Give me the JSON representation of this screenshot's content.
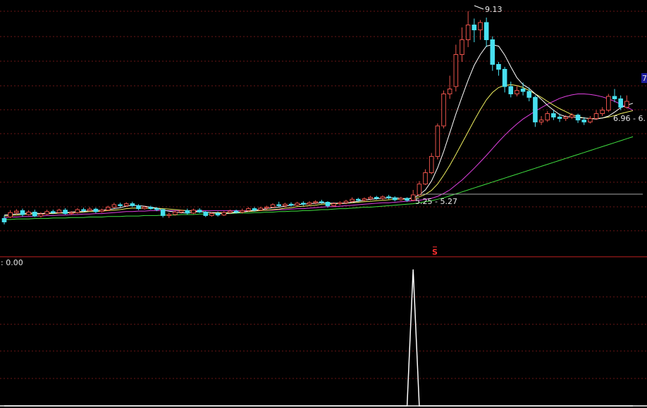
{
  "chart_data": [
    {
      "type": "candlestick",
      "ylim": [
        4.5,
        9.3
      ],
      "colors": {
        "up": "#e8524a",
        "down": "#48e0f0",
        "ma5": "#ffffff",
        "ma10": "#f0f060",
        "ma20": "#e040e0",
        "ma60": "#40e040",
        "grid": "#6a1616"
      },
      "annotations": {
        "high_label": "9.13",
        "range_label_mid": "5.25 - 5.27",
        "range_label_right": "6.96 - 6.",
        "edge_label": "7",
        "signal_marker": "S"
      },
      "candles": [
        [
          4.92,
          4.85,
          4.98,
          4.8
        ],
        [
          4.95,
          5.04,
          5.09,
          4.93
        ],
        [
          5.04,
          5.07,
          5.11,
          5.0
        ],
        [
          5.08,
          5.0,
          5.12,
          4.96
        ],
        [
          5.0,
          5.05,
          5.09,
          4.98
        ],
        [
          5.05,
          4.97,
          5.1,
          4.95
        ],
        [
          4.97,
          5.01,
          5.05,
          4.94
        ],
        [
          5.01,
          5.06,
          5.1,
          4.99
        ],
        [
          5.06,
          5.04,
          5.1,
          5.01
        ],
        [
          5.04,
          5.09,
          5.12,
          5.02
        ],
        [
          5.09,
          5.02,
          5.13,
          5.0
        ],
        [
          5.02,
          5.04,
          5.07,
          4.99
        ],
        [
          5.04,
          5.1,
          5.13,
          5.02
        ],
        [
          5.1,
          5.08,
          5.14,
          5.05
        ],
        [
          5.08,
          5.11,
          5.15,
          5.06
        ],
        [
          5.11,
          5.06,
          5.14,
          5.03
        ],
        [
          5.06,
          5.09,
          5.12,
          5.04
        ],
        [
          5.09,
          5.15,
          5.18,
          5.07
        ],
        [
          5.15,
          5.2,
          5.24,
          5.13
        ],
        [
          5.2,
          5.18,
          5.24,
          5.15
        ],
        [
          5.18,
          5.22,
          5.25,
          5.16
        ],
        [
          5.22,
          5.18,
          5.26,
          5.15
        ],
        [
          5.18,
          5.12,
          5.21,
          5.09
        ],
        [
          5.12,
          5.15,
          5.18,
          5.1
        ],
        [
          5.15,
          5.12,
          5.18,
          5.1
        ],
        [
          5.12,
          5.1,
          5.15,
          5.07
        ],
        [
          5.1,
          4.98,
          5.12,
          4.94
        ],
        [
          4.98,
          5.0,
          5.04,
          4.93
        ],
        [
          5.0,
          5.05,
          5.08,
          4.98
        ],
        [
          5.05,
          5.08,
          5.1,
          5.02
        ],
        [
          5.08,
          5.03,
          5.12,
          5.0
        ],
        [
          5.03,
          5.09,
          5.12,
          5.01
        ],
        [
          5.09,
          5.05,
          5.13,
          5.03
        ],
        [
          5.05,
          4.98,
          5.07,
          4.95
        ],
        [
          4.98,
          5.02,
          5.05,
          4.96
        ],
        [
          5.02,
          4.99,
          5.06,
          4.96
        ],
        [
          4.99,
          5.04,
          5.07,
          4.97
        ],
        [
          5.04,
          5.07,
          5.1,
          5.01
        ],
        [
          5.07,
          5.05,
          5.1,
          5.02
        ],
        [
          5.05,
          5.08,
          5.12,
          5.02
        ],
        [
          5.08,
          5.12,
          5.15,
          5.06
        ],
        [
          5.12,
          5.09,
          5.15,
          5.06
        ],
        [
          5.09,
          5.13,
          5.16,
          5.07
        ],
        [
          5.13,
          5.15,
          5.18,
          5.1
        ],
        [
          5.15,
          5.2,
          5.23,
          5.13
        ],
        [
          5.2,
          5.18,
          5.26,
          5.16
        ],
        [
          5.18,
          5.21,
          5.24,
          5.15
        ],
        [
          5.21,
          5.19,
          5.25,
          5.16
        ],
        [
          5.19,
          5.23,
          5.26,
          5.17
        ],
        [
          5.23,
          5.21,
          5.27,
          5.18
        ],
        [
          5.21,
          5.24,
          5.27,
          5.19
        ],
        [
          5.24,
          5.26,
          5.29,
          5.21
        ],
        [
          5.26,
          5.25,
          5.3,
          5.22
        ],
        [
          5.25,
          5.18,
          5.27,
          5.14
        ],
        [
          5.18,
          5.22,
          5.25,
          5.16
        ],
        [
          5.22,
          5.24,
          5.27,
          5.19
        ],
        [
          5.24,
          5.27,
          5.3,
          5.21
        ],
        [
          5.27,
          5.31,
          5.35,
          5.24
        ],
        [
          5.31,
          5.29,
          5.34,
          5.26
        ],
        [
          5.29,
          5.32,
          5.35,
          5.27
        ],
        [
          5.32,
          5.35,
          5.38,
          5.29
        ],
        [
          5.35,
          5.33,
          5.38,
          5.3
        ],
        [
          5.33,
          5.36,
          5.39,
          5.3
        ],
        [
          5.36,
          5.34,
          5.4,
          5.31
        ],
        [
          5.34,
          5.3,
          5.37,
          5.27
        ],
        [
          5.3,
          5.33,
          5.36,
          5.28
        ],
        [
          5.33,
          5.29,
          5.35,
          5.26
        ],
        [
          5.29,
          5.4,
          5.5,
          5.27
        ],
        [
          5.4,
          5.62,
          5.68,
          5.38
        ],
        [
          5.62,
          5.85,
          5.92,
          5.6
        ],
        [
          5.85,
          6.18,
          6.25,
          5.82
        ],
        [
          6.18,
          6.8,
          6.85,
          6.12
        ],
        [
          6.8,
          7.45,
          7.52,
          6.75
        ],
        [
          7.45,
          7.55,
          7.82,
          7.35
        ],
        [
          7.6,
          8.25,
          8.45,
          7.5
        ],
        [
          8.25,
          8.55,
          8.8,
          8.1
        ],
        [
          8.55,
          8.85,
          9.13,
          8.4
        ],
        [
          8.85,
          8.75,
          8.98,
          8.5
        ],
        [
          8.75,
          8.9,
          8.95,
          8.55
        ],
        [
          8.9,
          8.55,
          9.0,
          8.4
        ],
        [
          8.55,
          8.05,
          8.62,
          7.92
        ],
        [
          8.05,
          7.95,
          8.1,
          7.82
        ],
        [
          7.95,
          7.6,
          8.0,
          7.48
        ],
        [
          7.6,
          7.45,
          7.7,
          7.38
        ],
        [
          7.45,
          7.52,
          7.62,
          7.4
        ],
        [
          7.55,
          7.5,
          7.68,
          7.42
        ],
        [
          7.5,
          7.38,
          7.58,
          7.3
        ],
        [
          7.38,
          6.88,
          7.42,
          6.78
        ],
        [
          6.88,
          6.92,
          7.0,
          6.82
        ],
        [
          6.92,
          7.05,
          7.1,
          6.88
        ],
        [
          7.05,
          6.98,
          7.12,
          6.92
        ],
        [
          6.98,
          6.95,
          7.05,
          6.88
        ],
        [
          6.95,
          6.98,
          7.02,
          6.9
        ],
        [
          6.98,
          7.02,
          7.06,
          6.94
        ],
        [
          7.02,
          6.92,
          7.05,
          6.86
        ],
        [
          6.92,
          6.88,
          6.98,
          6.82
        ],
        [
          6.88,
          6.95,
          7.0,
          6.85
        ],
        [
          6.95,
          7.05,
          7.12,
          6.92
        ],
        [
          7.05,
          7.12,
          7.18,
          7.0
        ],
        [
          7.12,
          7.4,
          7.45,
          7.08
        ],
        [
          7.4,
          7.35,
          7.55,
          7.28
        ],
        [
          7.35,
          7.18,
          7.42,
          7.12
        ],
        [
          7.18,
          7.3,
          7.42,
          7.15
        ]
      ],
      "ma5": [
        4.99,
        5.0,
        5.01,
        5.02,
        5.03,
        5.03,
        5.02,
        5.03,
        5.03,
        5.04,
        5.04,
        5.05,
        5.06,
        5.06,
        5.08,
        5.08,
        5.09,
        5.1,
        5.12,
        5.14,
        5.17,
        5.19,
        5.18,
        5.17,
        5.15,
        5.13,
        5.09,
        5.07,
        5.05,
        5.04,
        5.03,
        5.05,
        5.06,
        5.05,
        5.04,
        5.03,
        5.02,
        5.03,
        5.04,
        5.05,
        5.07,
        5.09,
        5.1,
        5.12,
        5.14,
        5.15,
        5.17,
        5.19,
        5.2,
        5.21,
        5.22,
        5.23,
        5.24,
        5.23,
        5.23,
        5.23,
        5.23,
        5.25,
        5.27,
        5.29,
        5.31,
        5.32,
        5.33,
        5.34,
        5.34,
        5.33,
        5.32,
        5.34,
        5.4,
        5.5,
        5.68,
        5.95,
        6.28,
        6.66,
        7.04,
        7.39,
        7.73,
        8.03,
        8.25,
        8.42,
        8.45,
        8.42,
        8.24,
        8.0,
        7.78,
        7.64,
        7.56,
        7.45,
        7.34,
        7.22,
        7.12,
        7.03,
        6.99,
        6.98,
        6.97,
        6.96,
        6.95,
        6.94,
        6.96,
        7.0,
        7.08,
        7.17,
        7.22,
        7.26
      ],
      "ma10": [
        4.97,
        4.98,
        4.99,
        5.0,
        5.01,
        5.01,
        5.01,
        5.02,
        5.02,
        5.03,
        5.03,
        5.04,
        5.04,
        5.05,
        5.06,
        5.06,
        5.07,
        5.08,
        5.09,
        5.1,
        5.12,
        5.13,
        5.13,
        5.13,
        5.13,
        5.13,
        5.12,
        5.11,
        5.1,
        5.09,
        5.08,
        5.07,
        5.06,
        5.05,
        5.04,
        5.04,
        5.04,
        5.04,
        5.05,
        5.05,
        5.06,
        5.07,
        5.08,
        5.09,
        5.1,
        5.11,
        5.13,
        5.14,
        5.16,
        5.17,
        5.18,
        5.19,
        5.21,
        5.21,
        5.22,
        5.22,
        5.23,
        5.24,
        5.25,
        5.26,
        5.27,
        5.28,
        5.29,
        5.3,
        5.31,
        5.31,
        5.32,
        5.33,
        5.36,
        5.41,
        5.49,
        5.62,
        5.8,
        6.0,
        6.22,
        6.45,
        6.68,
        6.91,
        7.13,
        7.33,
        7.48,
        7.58,
        7.62,
        7.64,
        7.62,
        7.58,
        7.52,
        7.45,
        7.38,
        7.3,
        7.22,
        7.15,
        7.09,
        7.03,
        6.99,
        6.96,
        6.95,
        6.95,
        6.96,
        6.98,
        7.01,
        7.05,
        7.08,
        7.11
      ],
      "ma20": [
        4.94,
        4.95,
        4.95,
        4.96,
        4.96,
        4.97,
        4.97,
        4.98,
        4.98,
        4.99,
        4.99,
        5.0,
        5.0,
        5.01,
        5.01,
        5.02,
        5.02,
        5.03,
        5.04,
        5.05,
        5.06,
        5.06,
        5.07,
        5.07,
        5.08,
        5.08,
        5.08,
        5.08,
        5.08,
        5.08,
        5.08,
        5.08,
        5.08,
        5.08,
        5.08,
        5.08,
        5.08,
        5.08,
        5.08,
        5.08,
        5.08,
        5.08,
        5.09,
        5.09,
        5.09,
        5.1,
        5.1,
        5.11,
        5.12,
        5.12,
        5.13,
        5.14,
        5.15,
        5.16,
        5.16,
        5.17,
        5.18,
        5.19,
        5.2,
        5.21,
        5.22,
        5.23,
        5.24,
        5.24,
        5.25,
        5.26,
        5.27,
        5.28,
        5.29,
        5.31,
        5.33,
        5.37,
        5.43,
        5.5,
        5.6,
        5.7,
        5.82,
        5.94,
        6.07,
        6.2,
        6.34,
        6.48,
        6.61,
        6.73,
        6.84,
        6.94,
        7.02,
        7.1,
        7.17,
        7.24,
        7.3,
        7.36,
        7.4,
        7.43,
        7.45,
        7.45,
        7.44,
        7.42,
        7.39,
        7.35,
        7.3,
        7.24,
        7.18,
        7.12
      ],
      "ma60": [
        4.9,
        4.9,
        4.91,
        4.91,
        4.91,
        4.92,
        4.92,
        4.92,
        4.93,
        4.93,
        4.93,
        4.94,
        4.94,
        4.94,
        4.95,
        4.95,
        4.95,
        4.96,
        4.96,
        4.96,
        4.97,
        4.97,
        4.97,
        4.98,
        4.98,
        4.98,
        4.99,
        4.99,
        4.99,
        5.0,
        5.0,
        5.0,
        5.01,
        5.01,
        5.01,
        5.02,
        5.02,
        5.02,
        5.03,
        5.03,
        5.03,
        5.04,
        5.04,
        5.05,
        5.05,
        5.06,
        5.06,
        5.07,
        5.07,
        5.08,
        5.08,
        5.09,
        5.1,
        5.1,
        5.11,
        5.12,
        5.12,
        5.13,
        5.14,
        5.15,
        5.15,
        5.16,
        5.17,
        5.18,
        5.19,
        5.2,
        5.21,
        5.22,
        5.24,
        5.26,
        5.28,
        5.31,
        5.34,
        5.38,
        5.42,
        5.46,
        5.5,
        5.54,
        5.58,
        5.62,
        5.66,
        5.7,
        5.74,
        5.78,
        5.82,
        5.86,
        5.9,
        5.94,
        5.98,
        6.02,
        6.06,
        6.1,
        6.14,
        6.18,
        6.22,
        6.26,
        6.3,
        6.34,
        6.38,
        6.42,
        6.46,
        6.5,
        6.54,
        6.58
      ]
    },
    {
      "type": "line",
      "indicator_label": ": 0.00",
      "ylim": [
        0,
        1
      ],
      "signal": [
        0,
        0,
        0,
        0,
        0,
        0,
        0,
        0,
        0,
        0,
        0,
        0,
        0,
        0,
        0,
        0,
        0,
        0,
        0,
        0,
        0,
        0,
        0,
        0,
        0,
        0,
        0,
        0,
        0,
        0,
        0,
        0,
        0,
        0,
        0,
        0,
        0,
        0,
        0,
        0,
        0,
        0,
        0,
        0,
        0,
        0,
        0,
        0,
        0,
        0,
        0,
        0,
        0,
        0,
        0,
        0,
        0,
        0,
        0,
        0,
        0,
        0,
        0,
        0,
        0,
        0,
        0,
        1,
        0,
        0,
        0,
        0,
        0,
        0,
        0,
        0,
        0,
        0,
        0,
        0,
        0,
        0,
        0,
        0,
        0,
        0,
        0,
        0,
        0,
        0,
        0,
        0,
        0,
        0,
        0,
        0,
        0,
        0,
        0,
        0,
        0,
        0,
        0,
        0
      ],
      "colors": {
        "line": "#ffffff",
        "axis": "#c02020"
      }
    }
  ]
}
